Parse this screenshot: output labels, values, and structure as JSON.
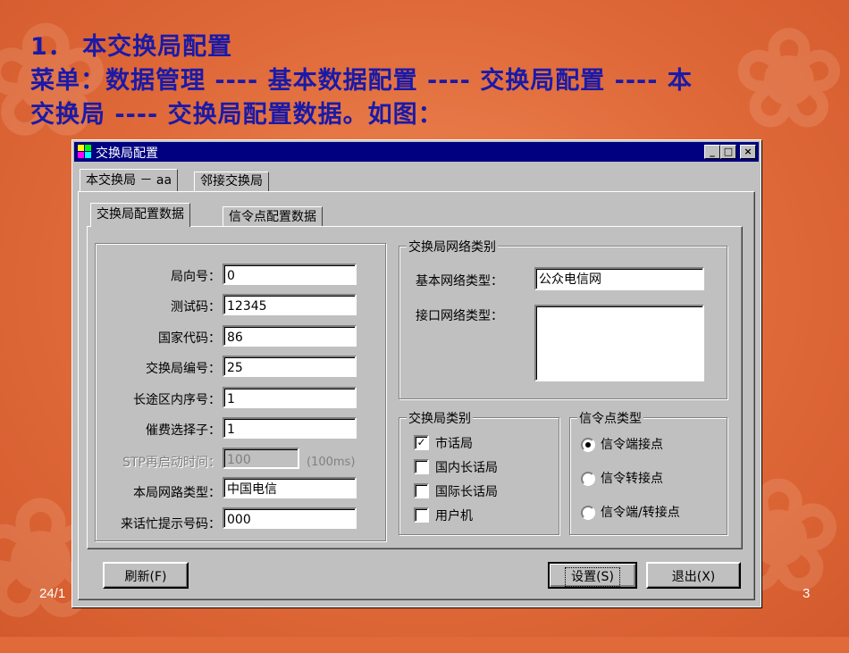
{
  "slide": {
    "line1": "1． 本交换局配置",
    "line2": "菜单：数据管理 ---- 基本数据配置 ---- 交换局配置 ---- 本",
    "line3": "交换局 ---- 交换局配置数据。如图：",
    "date": "24/1",
    "page": "3"
  },
  "window": {
    "title": "交换局配置",
    "title_buttons": [
      "_",
      "□",
      "×"
    ],
    "outer_tabs": [
      "本交换局 － aa",
      "邻接交换局"
    ],
    "inner_tabs": [
      "交换局配置数据",
      "信令点配置数据"
    ]
  },
  "form": {
    "direction_no": {
      "label": "局向号：",
      "value": "0"
    },
    "test_code": {
      "label": "测试码：",
      "value": "12345"
    },
    "country_code": {
      "label": "国家代码：",
      "value": "86"
    },
    "office_no": {
      "label": "交换局编号：",
      "value": "25"
    },
    "long_area_seq": {
      "label": "长途区内序号：",
      "value": "1"
    },
    "dunning_selector": {
      "label": "催费选择子：",
      "value": "1"
    },
    "stp_restart": {
      "label": "STP再启动时间：",
      "value": "100",
      "unit": "(100ms)"
    },
    "network_type": {
      "label": "本局网路类型：",
      "value": "中国电信"
    },
    "busy_prompt": {
      "label": "来话忙提示号码：",
      "value": "000"
    }
  },
  "network_group": {
    "title": "交换局网络类别",
    "basic_label": "基本网络类型：",
    "basic_value": "公众电信网",
    "interface_label": "接口网络类型：",
    "interface_value": ""
  },
  "office_type_group": {
    "title": "交换局类别",
    "options": [
      {
        "label": "市话局",
        "checked": true
      },
      {
        "label": "国内长话局",
        "checked": false
      },
      {
        "label": "国际长话局",
        "checked": false
      },
      {
        "label": "用户机",
        "checked": false
      }
    ]
  },
  "signal_group": {
    "title": "信令点类型",
    "options": [
      {
        "label": "信令端接点",
        "selected": true
      },
      {
        "label": "信令转接点",
        "selected": false
      },
      {
        "label": "信令端/转接点",
        "selected": false
      }
    ]
  },
  "buttons": {
    "refresh": "刷新(F)",
    "settings": "设置(S)",
    "exit": "退出(X)"
  },
  "colors": {
    "slide_bg": "#e06a3a",
    "slide_text": "#1a1aa8",
    "titlebar": "#000080",
    "window_face": "#c0c0c0"
  }
}
